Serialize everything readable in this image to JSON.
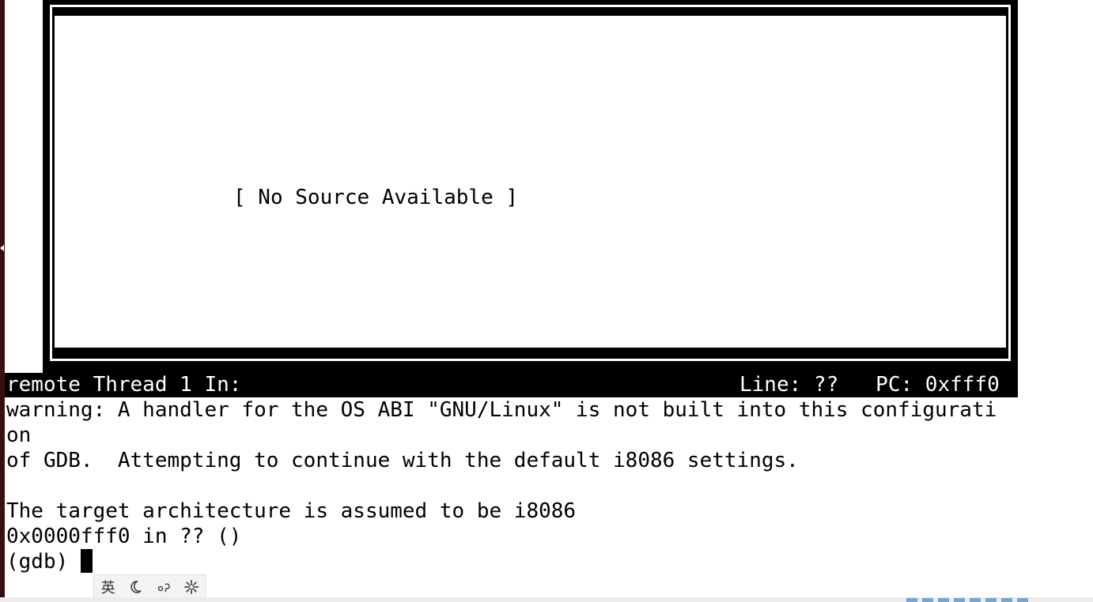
{
  "source_window": {
    "message": "[ No Source Available ]"
  },
  "status_bar": {
    "left": "remote Thread 1 In:",
    "right": "Line: ??   PC: 0xfff0"
  },
  "console": {
    "lines": [
      "warning: A handler for the OS ABI \"GNU/Linux\" is not built into this configurati",
      "on",
      "of GDB.  Attempting to continue with the default i8086 settings.",
      "",
      "The target architecture is assumed to be i8086",
      "0x0000fff0 in ?? ()"
    ],
    "prompt": "(gdb) "
  },
  "ime_toolbar": {
    "language": "英",
    "mode_icon": "moon-icon",
    "punct_icon": "punctuation-icon",
    "settings_icon": "gear-icon"
  }
}
